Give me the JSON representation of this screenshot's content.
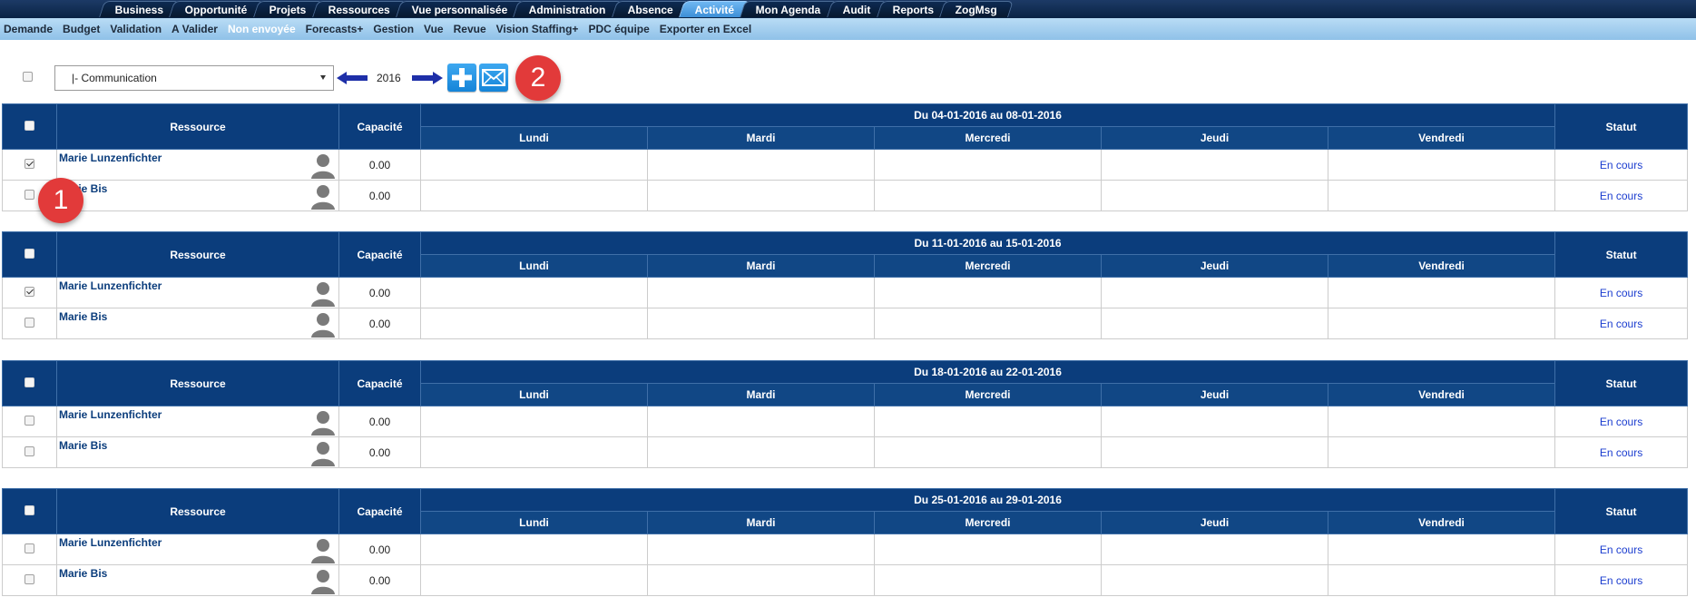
{
  "nav": {
    "tabs": [
      {
        "label": "Business",
        "active": false
      },
      {
        "label": "Opportunité",
        "active": false
      },
      {
        "label": "Projets",
        "active": false
      },
      {
        "label": "Ressources",
        "active": false
      },
      {
        "label": "Vue personnalisée",
        "active": false
      },
      {
        "label": "Administration",
        "active": false
      },
      {
        "label": "Absence",
        "active": false
      },
      {
        "label": "Activité",
        "active": true
      },
      {
        "label": "Mon Agenda",
        "active": false
      },
      {
        "label": "Audit",
        "active": false
      },
      {
        "label": "Reports",
        "active": false
      },
      {
        "label": "ZogMsg",
        "active": false
      }
    ],
    "subnav": [
      {
        "label": "Demande",
        "active": false
      },
      {
        "label": "Budget",
        "active": false
      },
      {
        "label": "Validation",
        "active": false
      },
      {
        "label": "A Valider",
        "active": false
      },
      {
        "label": "Non envoyée",
        "active": true
      },
      {
        "label": "Forecasts+",
        "active": false
      },
      {
        "label": "Gestion",
        "active": false
      },
      {
        "label": "Vue",
        "active": false
      },
      {
        "label": "Revue",
        "active": false
      },
      {
        "label": "Vision Staffing+",
        "active": false
      },
      {
        "label": "PDC équipe",
        "active": false
      },
      {
        "label": "Exporter en Excel",
        "active": false
      }
    ]
  },
  "toolbar": {
    "select_value": "|- Communication",
    "year": "2016",
    "badge_1": "1",
    "badge_2": "2",
    "add_icon": "plus-icon",
    "mail_icon": "envelope-icon"
  },
  "headers": {
    "ressource": "Ressource",
    "capacite": "Capacité",
    "statut": "Statut",
    "days": [
      "Lundi",
      "Mardi",
      "Mercredi",
      "Jeudi",
      "Vendredi"
    ]
  },
  "weeks": [
    {
      "range": "Du 04-01-2016 au 08-01-2016",
      "rows": [
        {
          "name": "Marie Lunzenfichter",
          "capacity": "0.00",
          "status": "En cours",
          "checked": true
        },
        {
          "name": "Marie Bis",
          "capacity": "0.00",
          "status": "En cours",
          "checked": false
        }
      ]
    },
    {
      "range": "Du 11-01-2016 au 15-01-2016",
      "rows": [
        {
          "name": "Marie Lunzenfichter",
          "capacity": "0.00",
          "status": "En cours",
          "checked": true
        },
        {
          "name": "Marie Bis",
          "capacity": "0.00",
          "status": "En cours",
          "checked": false
        }
      ]
    },
    {
      "range": "Du 18-01-2016 au 22-01-2016",
      "rows": [
        {
          "name": "Marie Lunzenfichter",
          "capacity": "0.00",
          "status": "En cours",
          "checked": false
        },
        {
          "name": "Marie Bis",
          "capacity": "0.00",
          "status": "En cours",
          "checked": false
        }
      ]
    },
    {
      "range": "Du 25-01-2016 au 29-01-2016",
      "rows": [
        {
          "name": "Marie Lunzenfichter",
          "capacity": "0.00",
          "status": "En cours",
          "checked": false
        },
        {
          "name": "Marie Bis",
          "capacity": "0.00",
          "status": "En cours",
          "checked": false
        }
      ]
    }
  ],
  "colors": {
    "header_blue": "#0b3d7c",
    "active_tab": "#3d8fd6",
    "status_link": "#1a3ccf",
    "badge_red": "#e23a3a"
  }
}
